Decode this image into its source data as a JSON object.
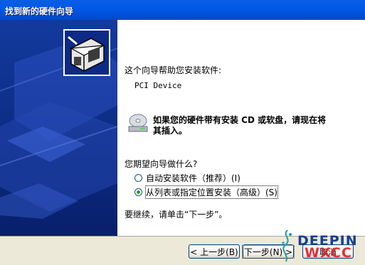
{
  "window": {
    "title": "找到新的硬件向导"
  },
  "content": {
    "intro": "这个向导帮助您安装软件:",
    "device_name": "PCI Device",
    "cd_prompt_line1": "如果您的硬件带有安装 CD 或软盘，请现在将",
    "cd_prompt_line2": "其插入。",
    "question": "您期望向导做什么?",
    "options": [
      {
        "label": "自动安装软件（推荐）(I)",
        "checked": false
      },
      {
        "label": "从列表或指定位置安装（高级）(S)",
        "checked": true
      }
    ],
    "continue_text": "要继续，请单击“下一步”。"
  },
  "buttons": {
    "back": "< 上一步(B)",
    "next": "下一步(N) >",
    "cancel": "取消"
  },
  "watermark": {
    "line1": "DEEPIN",
    "line2": "WXCC"
  },
  "colors": {
    "title_bar": "#0058e6",
    "side_panel": "#0c2a86",
    "radio_checked": "#21a121"
  }
}
